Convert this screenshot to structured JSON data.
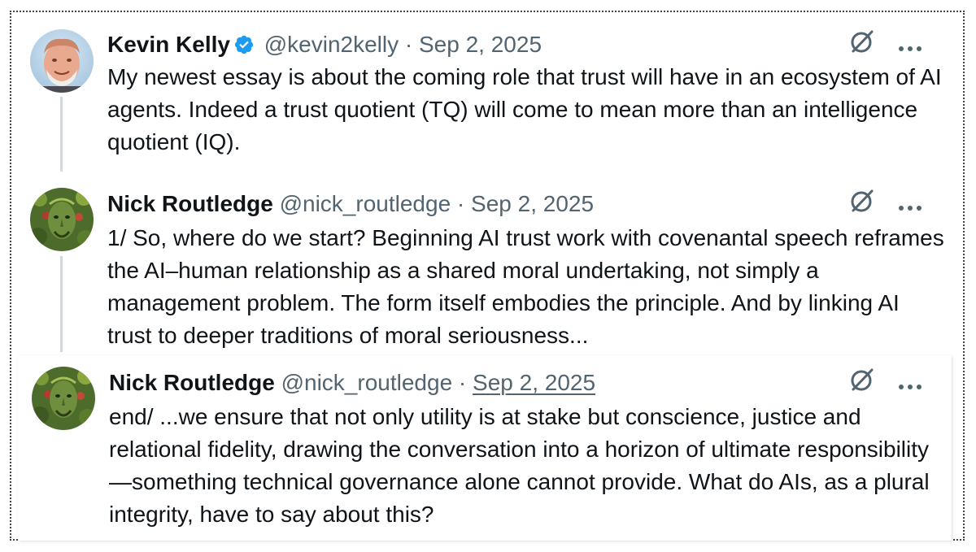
{
  "tweets": [
    {
      "name": "Kevin Kelly",
      "verified": true,
      "handle": "@kevin2kelly",
      "separator": "·",
      "date": "Sep 2, 2025",
      "text": "My newest essay is about the coming role that trust will have in an ecosystem of AI agents. Indeed a trust quotient (TQ) will come to mean more than an intelligence quotient (IQ).",
      "avatar_icon": "avatar-photo"
    },
    {
      "name": "Nick Routledge",
      "verified": false,
      "handle": "@nick_routledge",
      "separator": "·",
      "date": "Sep 2, 2025",
      "text": "1/ So, where do we start? Beginning AI trust work with covenantal speech reframes the AI–human relationship as a shared moral undertaking, not simply a management problem. The form itself embodies the principle. And by linking AI trust to deeper traditions of moral seriousness...",
      "avatar_icon": "green-face-avatar"
    },
    {
      "name": "Nick Routledge",
      "verified": false,
      "handle": "@nick_routledge",
      "separator": "·",
      "date": "Sep 2, 2025",
      "text": "end/ ...we ensure that not only utility is at stake but conscience, justice and relational fidelity, drawing the conversation into a horizon of ultimate responsibility—something technical governance alone cannot provide. What do AIs, as a plural integrity, have to say about this?",
      "avatar_icon": "green-face-avatar"
    }
  ],
  "icons": {
    "grok": "grok-icon",
    "more": "more-icon",
    "verified": "verified-badge-icon"
  },
  "colors": {
    "text": "#0f1419",
    "secondary": "#536471",
    "verified": "#1d9bf0",
    "thread_line": "#cfd9de"
  }
}
